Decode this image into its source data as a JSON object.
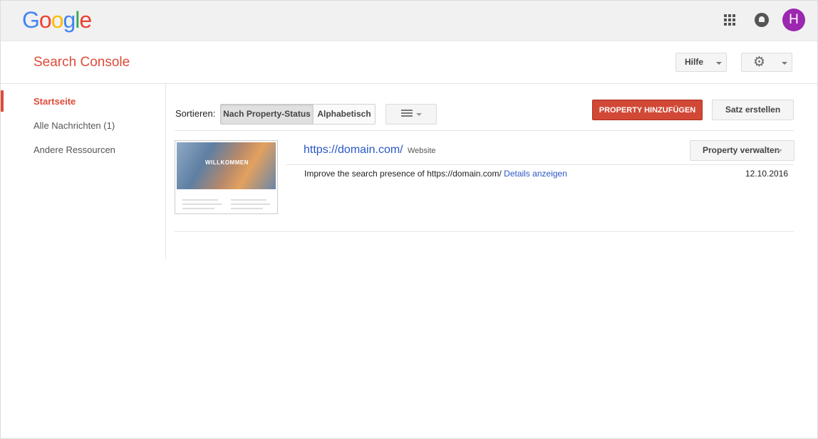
{
  "header": {
    "logo_letters": [
      {
        "char": "G",
        "color": "#4285f4"
      },
      {
        "char": "o",
        "color": "#ea4335"
      },
      {
        "char": "o",
        "color": "#fbbc05"
      },
      {
        "char": "g",
        "color": "#4285f4"
      },
      {
        "char": "l",
        "color": "#34a853"
      },
      {
        "char": "e",
        "color": "#ea4335"
      }
    ],
    "apps_icon": "apps-grid-icon",
    "notifications_icon": "bell-icon",
    "avatar_initial": "H",
    "avatar_color": "#9c27b0"
  },
  "console": {
    "title": "Search Console",
    "title_color": "#dd4b39",
    "help_label": "Hilfe",
    "settings_icon": "gear-icon"
  },
  "sidebar": {
    "items": [
      {
        "label": "Startseite",
        "active": true
      },
      {
        "label": "Alle Nachrichten (1)",
        "active": false
      },
      {
        "label": "Andere Ressourcen",
        "active": false
      }
    ]
  },
  "toolbar": {
    "sort_label": "Sortieren:",
    "sort_options": [
      {
        "label": "Nach Property-Status",
        "selected": true
      },
      {
        "label": "Alphabetisch",
        "selected": false
      }
    ],
    "view_icon": "list-view-icon",
    "add_property_label": "PROPERTY HINZUFÜGEN",
    "add_property_color": "#d14836",
    "create_set_label": "Satz erstellen"
  },
  "properties": [
    {
      "thumbnail_caption": "WILLKOMMEN",
      "url": "https://domain.com/",
      "type": "Website",
      "manage_label": "Property verwalten",
      "message": "Improve the search presence of https://domain.com/",
      "message_link": "Details anzeigen",
      "date": "12.10.2016"
    }
  ]
}
